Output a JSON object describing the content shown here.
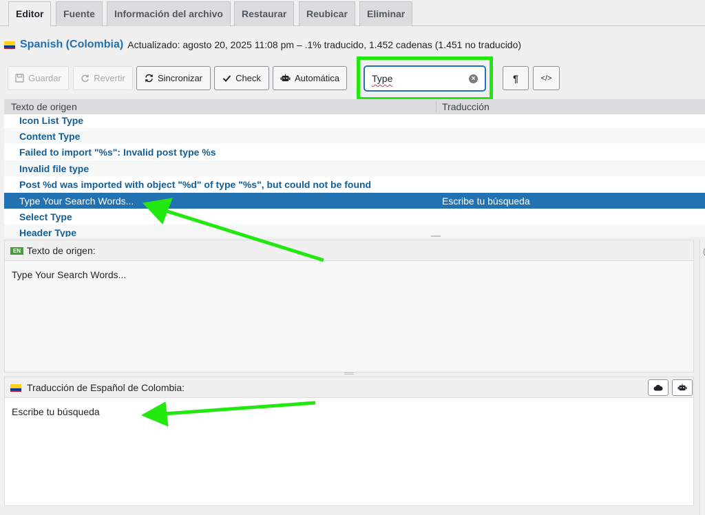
{
  "tabs": [
    "Editor",
    "Fuente",
    "Información del archivo",
    "Restaurar",
    "Reubicar",
    "Eliminar"
  ],
  "header": {
    "language": "Spanish (Colombia)",
    "meta": "Actualizado: agosto 20, 2025 11:08 pm – .1% traducido, 1.452 cadenas (1.451 no traducido)"
  },
  "toolbar": {
    "save": "Guardar",
    "revert": "Revertir",
    "sync": "Sincronizar",
    "check": "Check",
    "auto": "Automática",
    "search_value": "Type",
    "para_symbol": "¶",
    "code_symbol": "</>"
  },
  "table": {
    "col_source": "Texto de origen",
    "col_translation": "Traducción",
    "rows": [
      {
        "source": "Icon List Type",
        "translation": ""
      },
      {
        "source": "Content Type",
        "translation": ""
      },
      {
        "source": "Failed to import \"%s\": Invalid post type %s",
        "translation": ""
      },
      {
        "source": "Invalid file type",
        "translation": ""
      },
      {
        "source": "Post %d was imported with object \"%d\" of type \"%s\", but could not be found",
        "translation": ""
      },
      {
        "source": "Type Your Search Words...",
        "translation": "Escribe tu búsqueda"
      },
      {
        "source": "Select Type",
        "translation": ""
      },
      {
        "source": "Header Type",
        "translation": ""
      }
    ]
  },
  "source_panel": {
    "badge": "EN",
    "title": "Texto de origen:",
    "text": "Type Your Search Words..."
  },
  "translation_panel": {
    "title": "Traducción de Español de Colombia:",
    "text": "Escribe tu búsqueda"
  },
  "colors": {
    "accent": "#2271b1",
    "highlight": "#22e80f"
  }
}
